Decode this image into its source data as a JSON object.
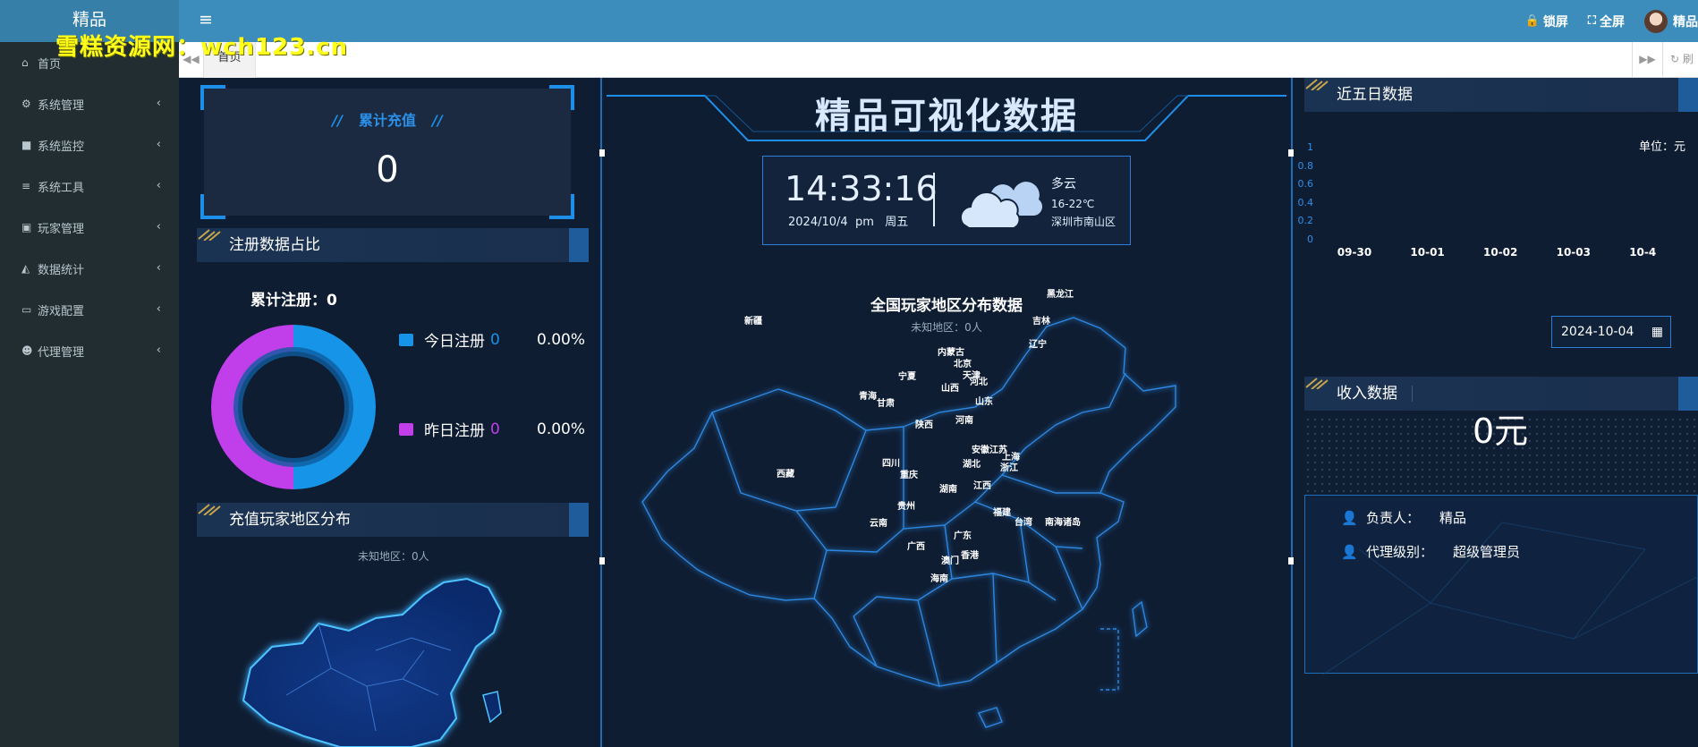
{
  "app": {
    "logo": "精品",
    "watermark": "雪糕资源网：wch123.cn"
  },
  "topbar": {
    "lock_label": "锁屏",
    "fullscreen_label": "全屏",
    "user_name": "精品"
  },
  "sidebar": {
    "items": [
      {
        "icon": "home-icon",
        "label": "首页",
        "has_arrow": false
      },
      {
        "icon": "gear-icon",
        "label": "系统管理",
        "has_arrow": true
      },
      {
        "icon": "video-icon",
        "label": "系统监控",
        "has_arrow": true
      },
      {
        "icon": "list-icon",
        "label": "系统工具",
        "has_arrow": true
      },
      {
        "icon": "id-card-icon",
        "label": "玩家管理",
        "has_arrow": true
      },
      {
        "icon": "area-chart-icon",
        "label": "数据统计",
        "has_arrow": true
      },
      {
        "icon": "desktop-icon",
        "label": "游戏配置",
        "has_arrow": true
      },
      {
        "icon": "users-icon",
        "label": "代理管理",
        "has_arrow": true
      }
    ]
  },
  "tabs": {
    "home": "首页",
    "refresh": "刷"
  },
  "dashboard": {
    "title": "精品可视化数据",
    "recharge": {
      "label": "累计充值",
      "value": "0"
    },
    "registration": {
      "title": "注册数据占比",
      "total_label": "累计注册：",
      "total_value": "0",
      "today_label": "今日注册",
      "today_count": "0",
      "today_pct": "0.00%",
      "yesterday_label": "昨日注册",
      "yesterday_count": "0",
      "yesterday_pct": "0.00%",
      "colors": {
        "today": "#1694e8",
        "yesterday": "#c13fea"
      }
    },
    "recharge_region": {
      "title": "充值玩家地区分布",
      "unknown": "未知地区：0人"
    },
    "clock": {
      "time": "14:33:16",
      "date": "2024/10/4",
      "ampm": "pm",
      "weekday": "周五"
    },
    "weather": {
      "desc": "多云",
      "temp": "16-22℃",
      "location": "深圳市南山区"
    },
    "map": {
      "title": "全国玩家地区分布数据",
      "unknown": "未知地区：0人",
      "provinces": [
        "黑龙江",
        "吉林",
        "辽宁",
        "新疆",
        "内蒙古",
        "北京",
        "天津",
        "宁夏",
        "河北",
        "山西",
        "青海",
        "甘肃",
        "山东",
        "陕西",
        "河南",
        "安徽",
        "江苏",
        "上海",
        "四川",
        "湖北",
        "西藏",
        "重庆",
        "浙江",
        "江西",
        "湖南",
        "贵州",
        "福建",
        "台湾",
        "南海诸岛",
        "云南",
        "广东",
        "广西",
        "澳门",
        "香港",
        "海南"
      ]
    },
    "recent_five": {
      "title": "近五日数据",
      "unit": "单位：元"
    },
    "income": {
      "title": "收入数据",
      "date": "2024-10-04",
      "value": "0元"
    },
    "info": {
      "owner_label": "负责人：",
      "owner_value": "精品",
      "level_label": "代理级别：",
      "level_value": "超级管理员"
    }
  },
  "chart_data": {
    "type": "bar",
    "categories": [
      "09-30",
      "10-01",
      "10-02",
      "10-03",
      "10-4"
    ],
    "values": [
      0,
      0,
      0,
      0,
      0
    ],
    "yticks": [
      "1",
      "0.8",
      "0.6",
      "0.4",
      "0.2",
      "0"
    ],
    "ylim": [
      0,
      1
    ],
    "title": "近五日数据",
    "ylabel": "单位：元"
  }
}
